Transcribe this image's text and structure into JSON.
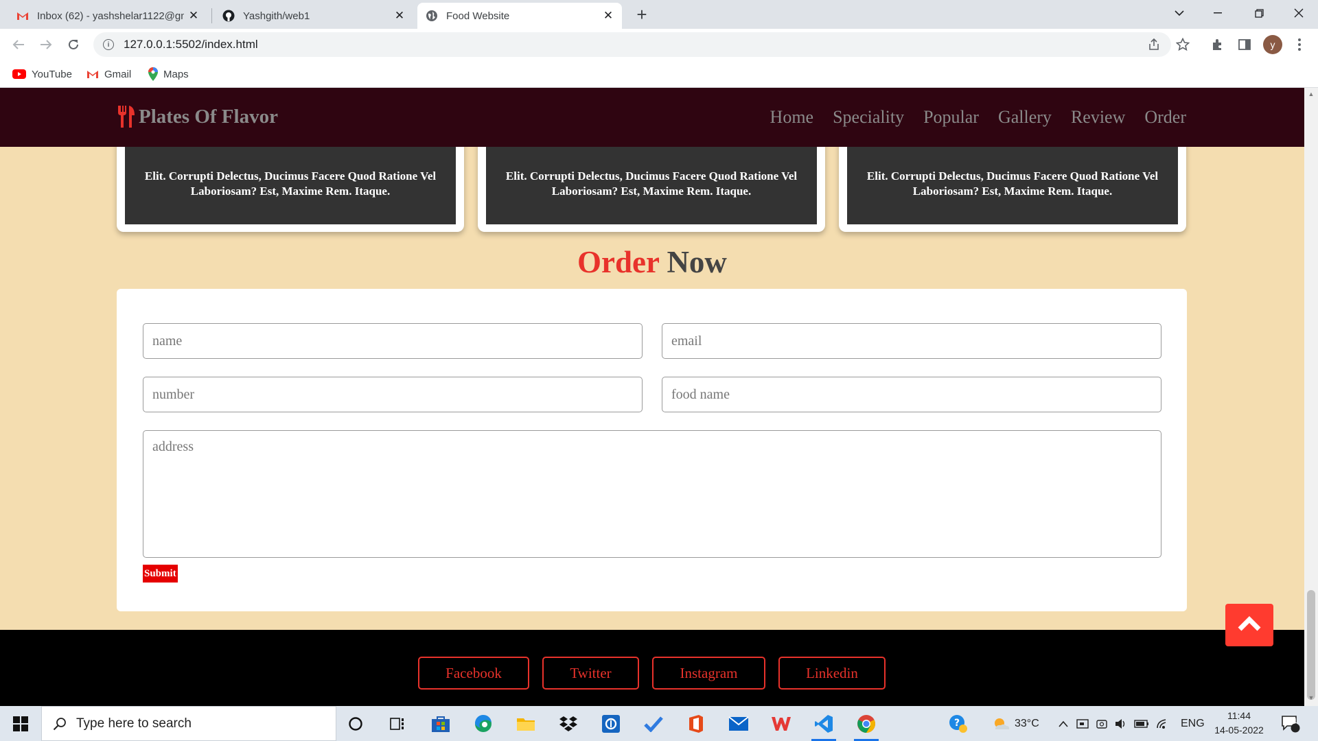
{
  "browser": {
    "tabs": [
      {
        "title": "Inbox (62) - yashshelar1122@gm",
        "icon": "gmail-icon"
      },
      {
        "title": "Yashgith/web1",
        "icon": "github-icon"
      },
      {
        "title": "Food Website",
        "icon": "globe-icon"
      }
    ],
    "close_glyph": "✕",
    "new_tab_glyph": "+",
    "url": "127.0.0.1:5502/index.html",
    "avatar_letter": "y",
    "bookmarks": [
      {
        "label": "YouTube",
        "icon": "youtube-icon"
      },
      {
        "label": "Gmail",
        "icon": "gmail-icon"
      },
      {
        "label": "Maps",
        "icon": "maps-icon"
      }
    ]
  },
  "site": {
    "brand": "Plates Of Flavor",
    "nav": [
      "Home",
      "Speciality",
      "Popular",
      "Gallery",
      "Review",
      "Order"
    ],
    "review_text": "Elit. Corrupti Delectus, Ducimus Facere Quod Ratione Vel Laboriosam? Est, Maxime Rem. Itaque.",
    "order_heading_accent": "Order",
    "order_heading_rest": "Now",
    "form": {
      "name_placeholder": "name",
      "email_placeholder": "email",
      "number_placeholder": "number",
      "food_placeholder": "food name",
      "address_placeholder": "address",
      "submit_label": "Submit"
    },
    "social": [
      "Facebook",
      "Twitter",
      "Instagram",
      "Linkedin"
    ]
  },
  "taskbar": {
    "search_placeholder": "Type here to search",
    "weather": "33°C",
    "language": "ENG",
    "time": "11:44",
    "date": "14-05-2022",
    "notification_count": "1"
  },
  "colors": {
    "header_bg": "#2f0511",
    "page_bg": "#f4ddb0",
    "accent": "#e8322b",
    "footer_bg": "#000000"
  }
}
